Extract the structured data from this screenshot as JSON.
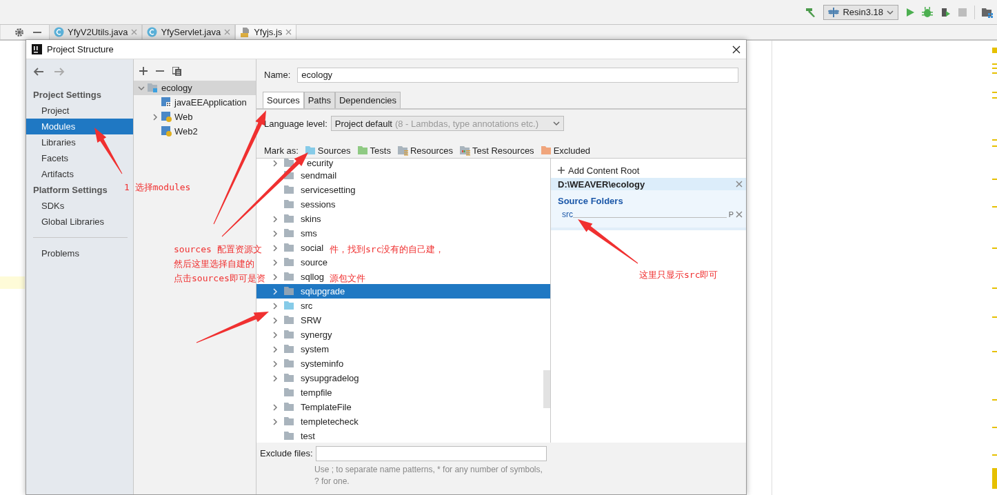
{
  "toolbar": {
    "run_config": "Resin3.18"
  },
  "editor_tabs": [
    {
      "label": "YfyV2Utils.java",
      "kind": "java",
      "selected": false
    },
    {
      "label": "YfyServlet.java",
      "kind": "java",
      "selected": false
    },
    {
      "label": "Yfyjs.js",
      "kind": "js",
      "selected": true
    }
  ],
  "dialog": {
    "title": "Project Structure",
    "sidebar": {
      "sections": [
        {
          "heading": "Project Settings",
          "items": [
            {
              "label": "Project",
              "selected": false
            },
            {
              "label": "Modules",
              "selected": true
            },
            {
              "label": "Libraries",
              "selected": false
            },
            {
              "label": "Facets",
              "selected": false
            },
            {
              "label": "Artifacts",
              "selected": false
            }
          ]
        },
        {
          "heading": "Platform Settings",
          "items": [
            {
              "label": "SDKs",
              "selected": false
            },
            {
              "label": "Global Libraries",
              "selected": false
            }
          ]
        }
      ],
      "footer_items": [
        {
          "label": "Problems",
          "selected": false
        }
      ]
    },
    "modules": [
      {
        "name": "ecology",
        "kind": "module",
        "expanded": true,
        "selected": true,
        "children": [
          {
            "name": "javaEEApplication",
            "kind": "app",
            "selected": false
          },
          {
            "name": "Web",
            "kind": "web",
            "expanded": false,
            "selected": false
          },
          {
            "name": "Web2",
            "kind": "web",
            "selected": false
          }
        ]
      }
    ],
    "name_label": "Name:",
    "name_value": "ecology",
    "tabs": [
      {
        "label": "Sources",
        "selected": true
      },
      {
        "label": "Paths",
        "selected": false
      },
      {
        "label": "Dependencies",
        "selected": false
      }
    ],
    "language_level": {
      "label": "Language level:",
      "value": "Project default",
      "hint": "(8 - Lambdas, type annotations etc.)"
    },
    "mark_as": {
      "label": "Mark as:",
      "options": [
        {
          "label": "Sources",
          "kind": "sources"
        },
        {
          "label": "Tests",
          "kind": "tests"
        },
        {
          "label": "Resources",
          "kind": "resources"
        },
        {
          "label": "Test Resources",
          "kind": "test_resources"
        },
        {
          "label": "Excluded",
          "kind": "excluded"
        }
      ]
    },
    "folders": [
      {
        "name": "ecurity",
        "kind": "plain",
        "expandable": true,
        "selected": false
      },
      {
        "name": "sendmail",
        "kind": "plain",
        "expandable": false,
        "selected": false
      },
      {
        "name": "servicesetting",
        "kind": "plain",
        "expandable": false,
        "selected": false
      },
      {
        "name": "sessions",
        "kind": "plain",
        "expandable": false,
        "selected": false
      },
      {
        "name": "skins",
        "kind": "plain",
        "expandable": true,
        "selected": false
      },
      {
        "name": "sms",
        "kind": "plain",
        "expandable": true,
        "selected": false
      },
      {
        "name": "social",
        "kind": "plain",
        "expandable": true,
        "selected": false
      },
      {
        "name": "source",
        "kind": "plain",
        "expandable": true,
        "selected": false
      },
      {
        "name": "sqllog",
        "kind": "plain",
        "expandable": true,
        "selected": false
      },
      {
        "name": "sqlupgrade",
        "kind": "plain",
        "expandable": true,
        "selected": true
      },
      {
        "name": "src",
        "kind": "source",
        "expandable": true,
        "selected": false
      },
      {
        "name": "SRW",
        "kind": "plain",
        "expandable": true,
        "selected": false
      },
      {
        "name": "synergy",
        "kind": "plain",
        "expandable": true,
        "selected": false
      },
      {
        "name": "system",
        "kind": "plain",
        "expandable": true,
        "selected": false
      },
      {
        "name": "systeminfo",
        "kind": "plain",
        "expandable": true,
        "selected": false
      },
      {
        "name": "sysupgradelog",
        "kind": "plain",
        "expandable": true,
        "selected": false
      },
      {
        "name": "tempfile",
        "kind": "plain",
        "expandable": false,
        "selected": false
      },
      {
        "name": "TemplateFile",
        "kind": "plain",
        "expandable": true,
        "selected": false
      },
      {
        "name": "templetecheck",
        "kind": "plain",
        "expandable": true,
        "selected": false
      },
      {
        "name": "test",
        "kind": "plain",
        "expandable": false,
        "selected": false
      }
    ],
    "content_root": {
      "add_label": "Add Content Root",
      "path": "D:\\WEAVER\\ecology",
      "section": "Source Folders",
      "entries": [
        {
          "name": "src",
          "suffix": "P"
        }
      ]
    },
    "exclude": {
      "label": "Exclude files:",
      "hint": "Use ; to separate name patterns, * for any number of symbols, ? for one."
    }
  },
  "annotations": [
    {
      "lines": [
        "1 选择modules"
      ]
    },
    {
      "lines": [
        "sources 配置资源文",
        "件，找到src没有的自己建，",
        "然后这里选择自建的",
        "点击sources即可是资",
        "源包文件"
      ]
    },
    {
      "lines": [
        "这里只显示src即可"
      ]
    }
  ]
}
